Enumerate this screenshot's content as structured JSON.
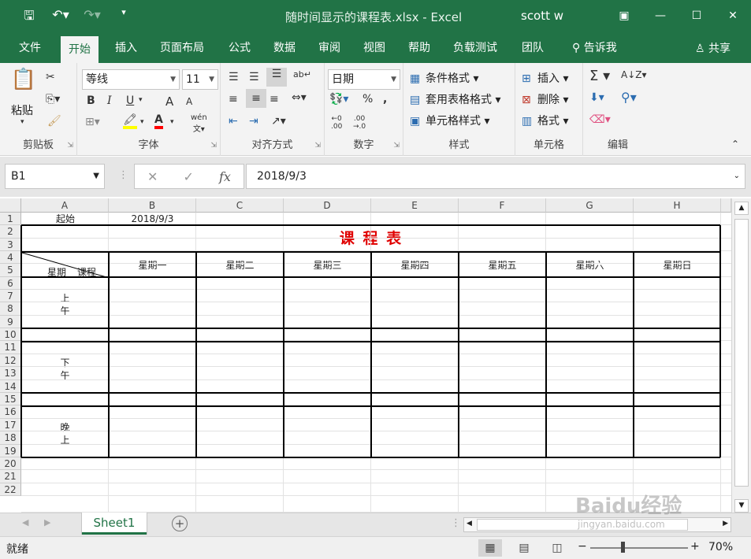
{
  "titlebar": {
    "save_icon": "save-icon",
    "undo_icon": "undo-icon",
    "redo_icon": "redo-icon",
    "document_title": "随时间显示的课程表.xlsx  -  Excel",
    "user": "scott w"
  },
  "menu": {
    "tabs": [
      "文件",
      "开始",
      "插入",
      "页面布局",
      "公式",
      "数据",
      "审阅",
      "视图",
      "帮助",
      "负载测试",
      "团队",
      "告诉我"
    ],
    "active": "开始",
    "share": "共享"
  },
  "ribbon": {
    "clipboard": {
      "paste": "粘贴",
      "label": "剪贴板"
    },
    "font": {
      "name": "等线",
      "size": "11",
      "label": "字体",
      "bold": "B",
      "italic": "I",
      "underline": "U",
      "grow": "A",
      "shrink": "A",
      "pinyin": "wén",
      "font_color": "#ff0000",
      "fill_color": "#ffff00"
    },
    "alignment": {
      "label": "对齐方式"
    },
    "number": {
      "format": "日期",
      "label": "数字"
    },
    "styles": {
      "conditional": "条件格式",
      "table": "套用表格格式",
      "cell": "单元格样式",
      "label": "样式"
    },
    "cells": {
      "insert": "插入",
      "delete": "删除",
      "format": "格式",
      "label": "单元格"
    },
    "editing": {
      "label": "编辑"
    }
  },
  "formula_bar": {
    "name_box": "B1",
    "formula": "2018/9/3"
  },
  "grid": {
    "columns": [
      "A",
      "B",
      "C",
      "D",
      "E",
      "F",
      "G",
      "H"
    ],
    "rows": [
      "1",
      "2",
      "3",
      "4",
      "5",
      "6",
      "7",
      "8",
      "9",
      "10",
      "11",
      "12",
      "13",
      "14",
      "15",
      "16",
      "17",
      "18",
      "19",
      "20",
      "21",
      "22"
    ],
    "a1": "起始",
    "b1": "2018/9/3",
    "title": "课 程 表",
    "title_color": "#e00000",
    "corner_left": "星期",
    "corner_right": "课程",
    "weekdays": [
      "星期一",
      "星期二",
      "星期三",
      "星期四",
      "星期五",
      "星期六",
      "星期日"
    ],
    "periods": [
      {
        "line1": "上",
        "line2": "午"
      },
      {
        "line1": "下",
        "line2": "午"
      },
      {
        "line1": "晚",
        "line2": "上"
      }
    ]
  },
  "sheets": {
    "tabs": [
      "Sheet1"
    ],
    "active": "Sheet1",
    "add_icon": "plus-icon"
  },
  "status": {
    "ready": "就绪",
    "zoom": "70%",
    "zoom_out": "−",
    "zoom_in": "+"
  },
  "watermark": {
    "text": "Baidu经验",
    "url_text": "jingyan.baidu.com"
  }
}
